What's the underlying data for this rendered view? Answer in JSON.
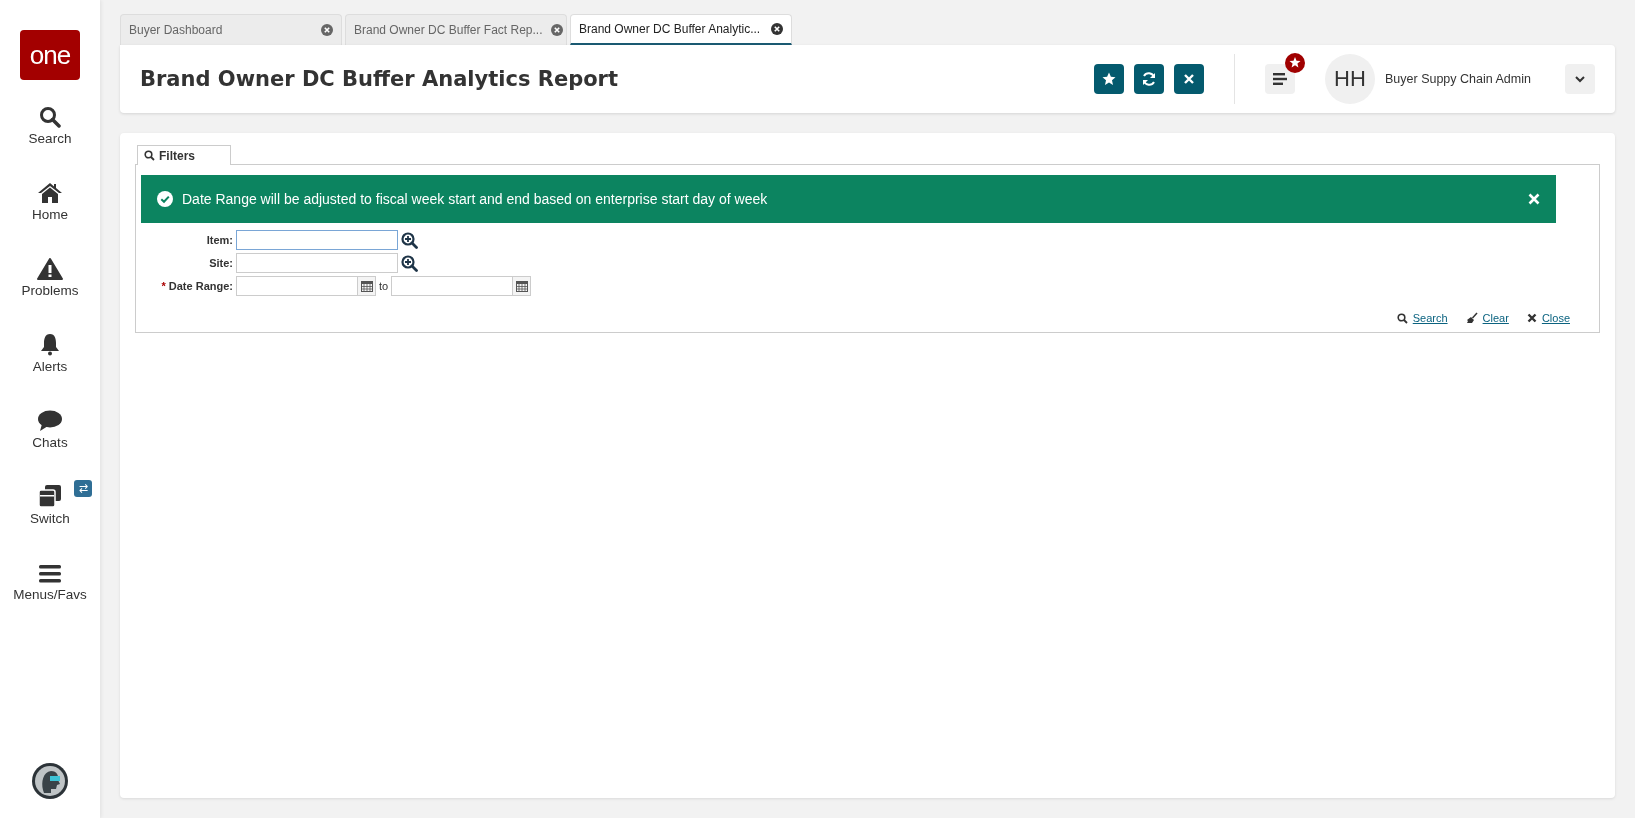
{
  "logo": {
    "text": "one"
  },
  "sidebar": {
    "items": [
      {
        "label": "Search"
      },
      {
        "label": "Home"
      },
      {
        "label": "Problems"
      },
      {
        "label": "Alerts"
      },
      {
        "label": "Chats"
      },
      {
        "label": "Switch",
        "badge": "⇄"
      },
      {
        "label": "Menus/Favs"
      }
    ]
  },
  "tabs": [
    {
      "label": "Buyer Dashboard",
      "selected": false
    },
    {
      "label": "Brand Owner DC Buffer Fact Rep...",
      "selected": false
    },
    {
      "label": "Brand Owner DC Buffer Analytic...",
      "selected": true
    }
  ],
  "header": {
    "title": "Brand Owner DC Buffer Analytics Report",
    "user_initials": "HH",
    "user_role": "Buyer Suppy Chain Admin"
  },
  "filters": {
    "tab_label": "Filters",
    "banner": "Date Range will be adjusted to fiscal week start and end based on enterprise start day of week",
    "fields": [
      {
        "label": "Item:",
        "kind": "lookup",
        "focused": true
      },
      {
        "label": "Site:",
        "kind": "lookup",
        "focused": false
      },
      {
        "label": "Date Range:",
        "kind": "daterange",
        "required_mark": "*",
        "focused": false,
        "separator": "to"
      }
    ],
    "actions": [
      {
        "label": "Search"
      },
      {
        "label": "Clear"
      },
      {
        "label": "Close"
      }
    ]
  }
}
